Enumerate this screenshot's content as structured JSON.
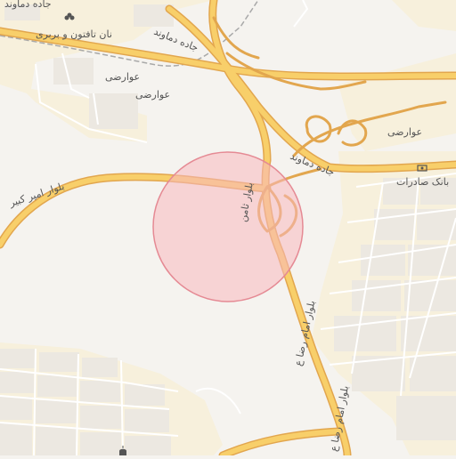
{
  "map": {
    "colors": {
      "background": "#f5f3ef",
      "urban_area": "#f7f0dc",
      "block": "#ece8e1",
      "block_outline": "#ffffff",
      "road_casing": "#e2a64e",
      "road_fill": "#f8cf6a",
      "residential_road": "#ffffff",
      "railway": "#a9a9a9",
      "label_text": "#555555",
      "circle_fill": "#f7b8bd",
      "circle_stroke": "#e58a94"
    },
    "labels": {
      "damavand_road_top": "جاده دماوند",
      "damavand_road_mid": "جاده دماوند",
      "damavand_top_left": "جاده دماوند",
      "bakery": "نان تافتون و بربری",
      "avarezi_1": "عوارضی",
      "avarezi_2": "عوارضی",
      "avarezi_3": "عوارضی",
      "amir_kabir": "بلوار امیر کبیر",
      "samen": "بلوار ثامن",
      "imam_reza_1": "بلوار امام رضا ع",
      "imam_reza_2": "بلوار امام رضا ع",
      "bank_saderat": "بانک صادرات"
    },
    "icons": {
      "bakery": "bakery-icon",
      "bank": "bank-icon",
      "mosque": "mosque-icon"
    },
    "highlight": {
      "shape": "circle"
    }
  }
}
